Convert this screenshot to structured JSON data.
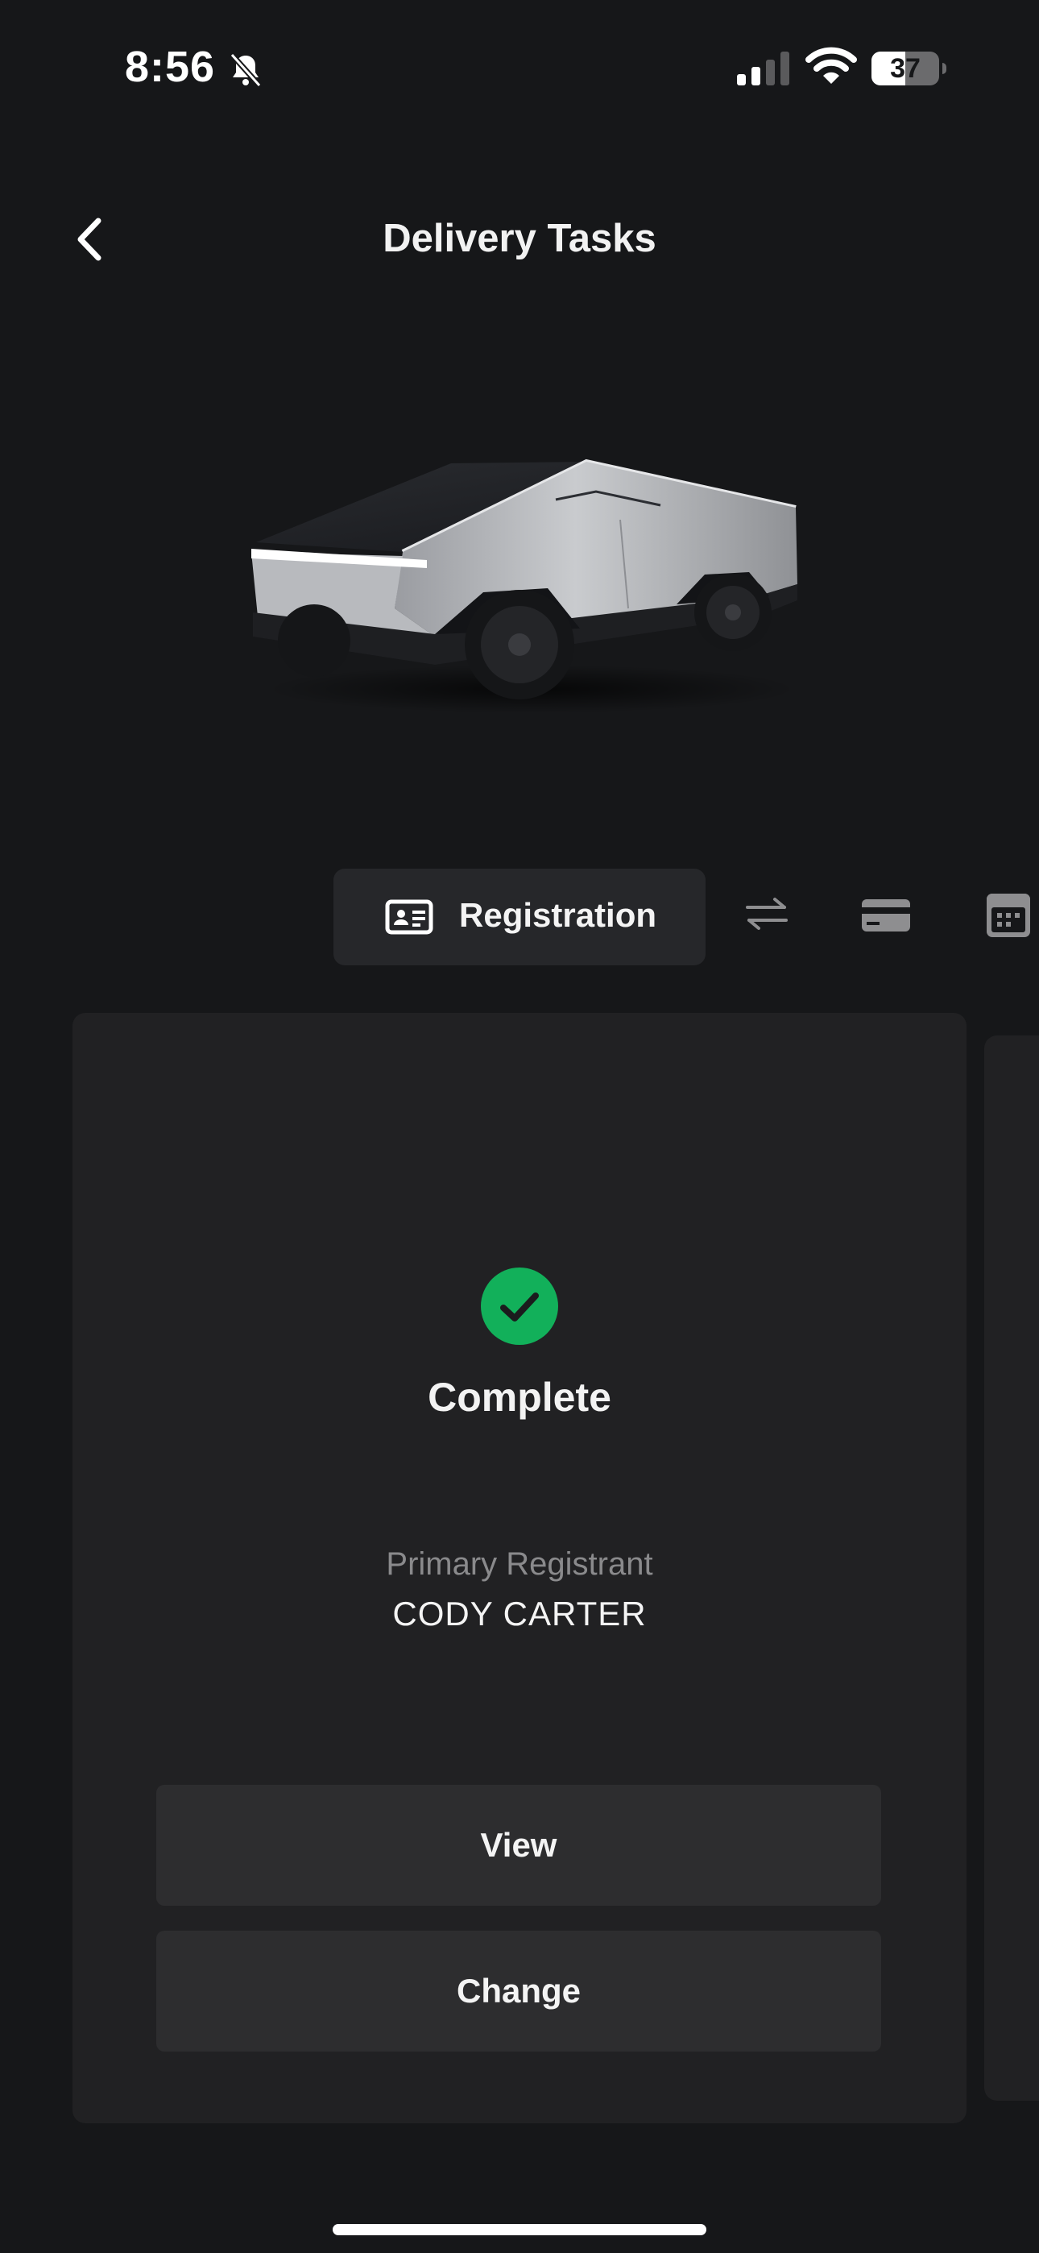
{
  "status_bar": {
    "time": "8:56",
    "battery": "37"
  },
  "header": {
    "title": "Delivery Tasks"
  },
  "tabs": {
    "active_label": "Registration"
  },
  "card": {
    "status": "Complete",
    "registrant_caption": "Primary Registrant",
    "registrant_name": "CODY CARTER",
    "view_button": "View",
    "change_button": "Change"
  },
  "colors": {
    "background": "#161719",
    "card": "#212123",
    "button": "#2d2d2f",
    "success": "#12b05a"
  }
}
